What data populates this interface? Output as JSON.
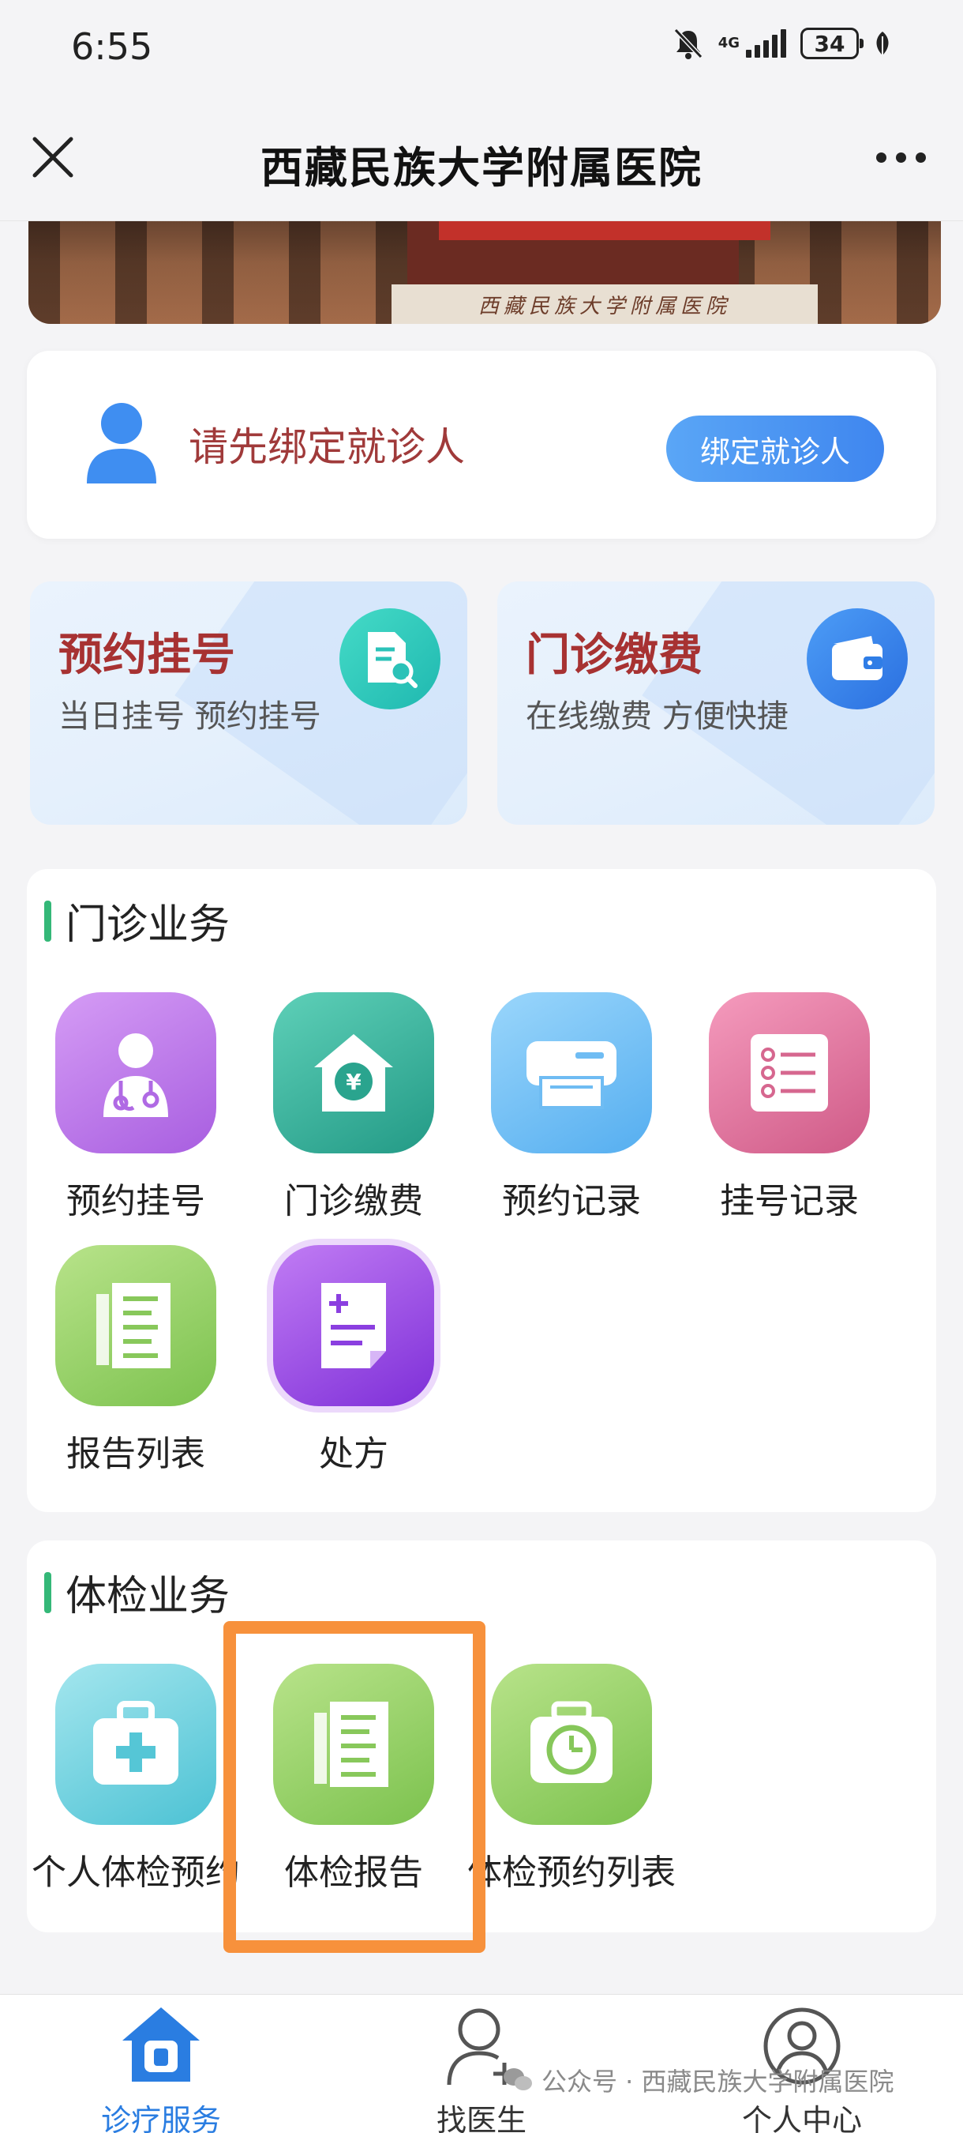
{
  "status_bar": {
    "time": "6:55",
    "network": "4G",
    "battery": "34"
  },
  "header": {
    "title": "西藏民族大学附属医院"
  },
  "banner": {
    "sign_text": "西藏民族大学附属医院"
  },
  "bind_card": {
    "prompt": "请先绑定就诊人",
    "button_label": "绑定就诊人"
  },
  "quick_cards": [
    {
      "title": "预约挂号",
      "subtitle": "当日挂号 预约挂号",
      "icon": "document-search-icon"
    },
    {
      "title": "门诊缴费",
      "subtitle": "在线缴费 方便快捷",
      "icon": "wallet-icon"
    }
  ],
  "outpatient": {
    "title": "门诊业务",
    "items": [
      {
        "label": "预约挂号",
        "icon": "doctor-icon"
      },
      {
        "label": "门诊缴费",
        "icon": "yuan-house-icon"
      },
      {
        "label": "预约记录",
        "icon": "printer-icon"
      },
      {
        "label": "挂号记录",
        "icon": "list-icon"
      },
      {
        "label": "报告列表",
        "icon": "report-icon"
      },
      {
        "label": "处方",
        "icon": "prescription-icon"
      }
    ]
  },
  "checkup": {
    "title": "体检业务",
    "items": [
      {
        "label": "个人体检预约",
        "icon": "medical-kit-icon"
      },
      {
        "label": "体检报告",
        "icon": "report-icon"
      },
      {
        "label": "体检预约列表",
        "icon": "calendar-clock-icon"
      }
    ]
  },
  "bottom_nav": {
    "items": [
      {
        "label": "诊疗服务",
        "icon": "home-icon",
        "active": true
      },
      {
        "label": "找医生",
        "icon": "add-person-icon",
        "active": false
      },
      {
        "label": "个人中心",
        "icon": "user-circle-icon",
        "active": false
      }
    ]
  },
  "watermark": "公众号 · 西藏民族大学附属医院",
  "colors": {
    "accent_blue": "#3f86ef",
    "title_red": "#a73232",
    "section_green": "#34b878",
    "highlight_orange": "#f7913c"
  }
}
